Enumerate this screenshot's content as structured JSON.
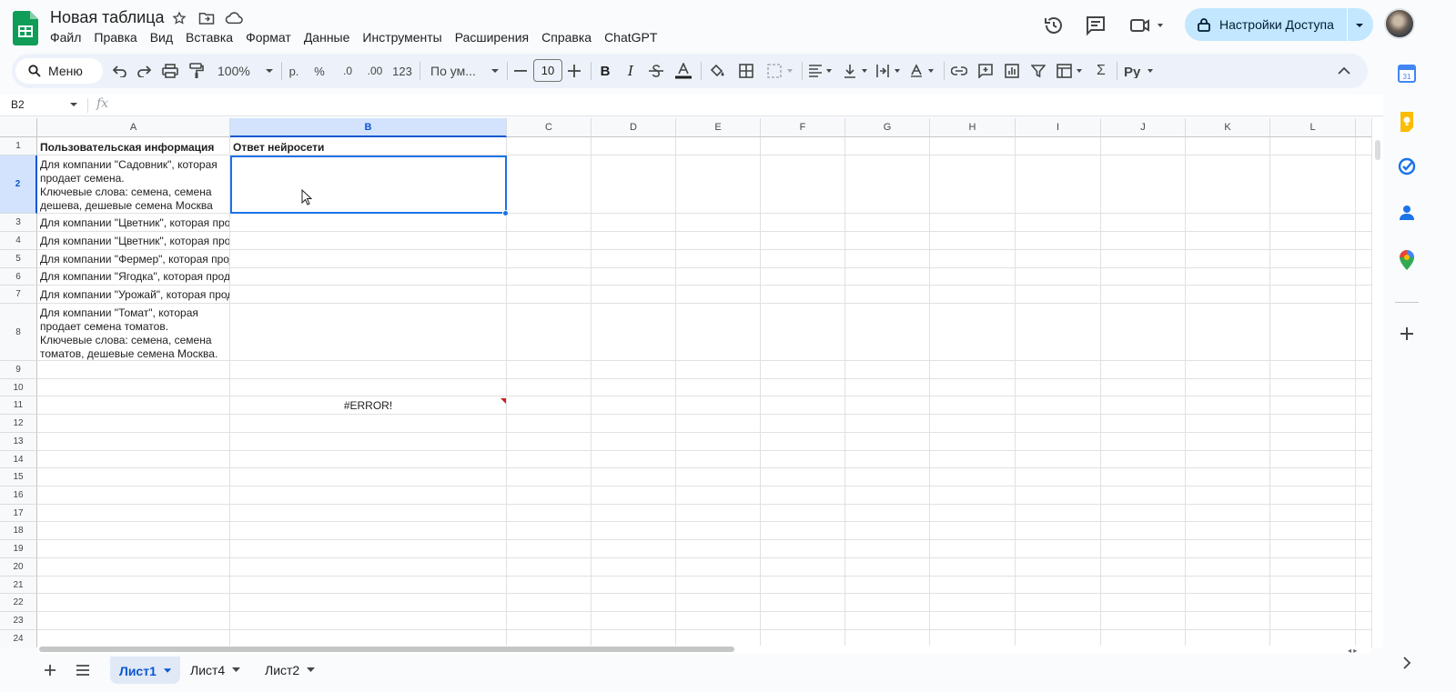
{
  "header": {
    "doc_title": "Новая таблица",
    "menu": [
      "Файл",
      "Правка",
      "Вид",
      "Вставка",
      "Формат",
      "Данные",
      "Инструменты",
      "Расширения",
      "Справка",
      "ChatGPT"
    ],
    "share_label": "Настройки Доступа",
    "brand_color": "#0f9d58",
    "share_bg": "#c2e7ff"
  },
  "toolbar": {
    "menu_label": "Меню",
    "zoom": "100%",
    "currency": "р.",
    "percent": "%",
    "dec_decrease": ".0",
    "dec_increase": ".00",
    "format_123": "123",
    "font": "По ум...",
    "font_size": "10"
  },
  "formula_bar": {
    "cell_ref": "B2",
    "fx": "fx"
  },
  "grid": {
    "columns": [
      "A",
      "B",
      "C",
      "D",
      "E",
      "F",
      "G",
      "H",
      "I",
      "J",
      "K",
      "L"
    ],
    "selected_column": "B",
    "selected_row": "2",
    "rows": [
      "1",
      "2",
      "3",
      "4",
      "5",
      "6",
      "7",
      "8",
      "9",
      "10",
      "11",
      "12",
      "13",
      "14",
      "15",
      "16",
      "17",
      "18",
      "19",
      "20",
      "21",
      "22",
      "23",
      "24"
    ],
    "cells": {
      "A1": "Пользовательская информация",
      "B1": "Ответ нейросети",
      "A2": "Для компании \"Садовник\", которая продает семена.\nКлючевые слова: семена, семена дешева, дешевые семена Москва",
      "A3": "Для компании \"Цветник\", которая продает",
      "A4": "Для компании \"Цветник\", которая продает",
      "A5": "Для компании \"Фермер\", которая продает",
      "A6": "Для компании \"Ягодка\", которая продает",
      "A7": "Для компании \"Урожай\", которая продает",
      "A8": "Для компании \"Томат\", которая продает семена томатов.\nКлючевые слова: семена, семена томатов, дешевые семена Москва.",
      "B11": "#ERROR!"
    },
    "selection_color": "#1a73e8",
    "error_color": "#c5221f"
  },
  "sheets": {
    "tabs": [
      "Лист1",
      "Лист4",
      "Лист2"
    ],
    "active": "Лист1"
  }
}
